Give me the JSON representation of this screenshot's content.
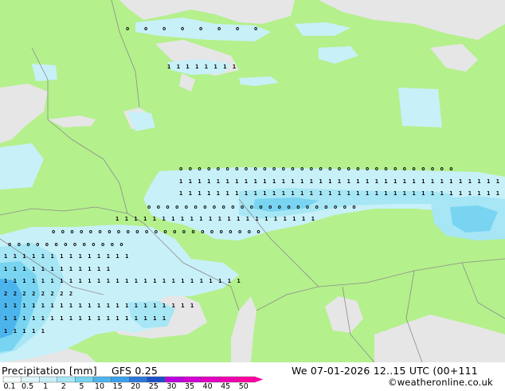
{
  "footer": {
    "title": "Precipitation [mm]",
    "model": "GFS 0.25",
    "datetime": "We 07-01-2026 12..15 UTC (00+111",
    "credit": "©weatheronline.co.uk"
  },
  "legend": {
    "ticks": [
      "0.1",
      "0.5",
      "1",
      "2",
      "5",
      "10",
      "15",
      "20",
      "25",
      "30",
      "35",
      "40",
      "45",
      "50"
    ],
    "colors": [
      "#f5fdfd",
      "#e0f6fa",
      "#c8f0f8",
      "#a6e6f5",
      "#78d4f0",
      "#4cb4ec",
      "#3ca0ec",
      "#2c78dc",
      "#1c50c8",
      "#bc00e0",
      "#d400d4",
      "#e400c4",
      "#f000b4",
      "#fc00a0"
    ]
  },
  "map": {
    "land_color": "#b4f08c",
    "sea_color": "#e6e6e6"
  }
}
